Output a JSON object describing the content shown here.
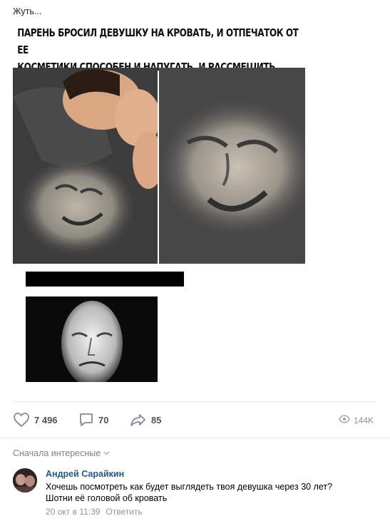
{
  "post": {
    "text": "Жуть..."
  },
  "meme": {
    "caption_line1": "ПАРЕНЬ БРОСИЛ ДЕВУШКУ НА КРОВАТЬ, И ОТПЕЧАТОК ОТ ЕЕ",
    "caption_line2": "КОСМЕТИКИ СПОСОБЕН И НАПУГАТЬ, И РАССМЕШИТЬ"
  },
  "actions": {
    "likes": "7 496",
    "comments": "70",
    "shares": "85",
    "views": "144K"
  },
  "comments_section": {
    "sort_label": "Сначала интересные"
  },
  "comment": {
    "author": "Андрей Сарайкин",
    "line1": "Хочешь посмотреть как будет выглядеть твоя девушка через 30 лет?",
    "line2": "Шотни её головой об кровать",
    "date": "20 окт в 11:39",
    "reply_label": "Ответить"
  },
  "icons": {
    "like": "heart-icon",
    "comment": "comment-icon",
    "share": "share-arrow-icon",
    "views": "eye-icon",
    "sort": "chevron-down-icon"
  },
  "colors": {
    "author_link": "#2a5885",
    "action_icon": "#828282",
    "divider": "#e7e8ec"
  }
}
